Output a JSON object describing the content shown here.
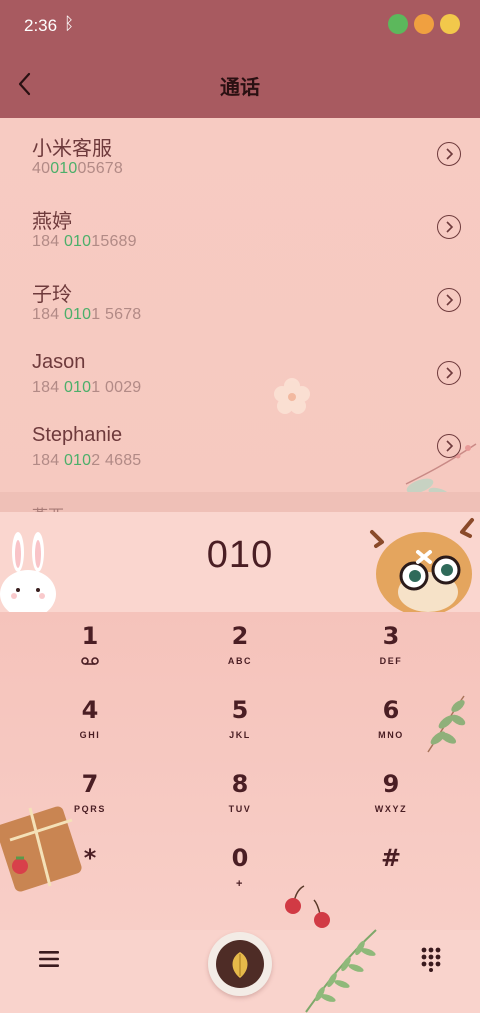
{
  "status": {
    "time": "2:36",
    "bluetooth_glyph": "ᛒ",
    "icons": [
      "clover-icon",
      "fruit-icon",
      "chick-icon"
    ]
  },
  "header": {
    "title": "通话",
    "back_icon": "chevron-left-icon"
  },
  "contacts": [
    {
      "name": "小米客服",
      "num_pre": "40",
      "num_hl": "010",
      "num_post": "05678"
    },
    {
      "name": "燕婷",
      "num_pre": "184 ",
      "num_hl": "010",
      "num_post": "15689"
    },
    {
      "name": "子玲",
      "num_pre": "184 ",
      "num_hl": "010",
      "num_post": "1 5678"
    },
    {
      "name": "Jason",
      "num_pre": "184 ",
      "num_hl": "010",
      "num_post": "1 0029"
    },
    {
      "name": "Stephanie",
      "num_pre": "184 ",
      "num_hl": "010",
      "num_post": "2 4685"
    }
  ],
  "partial_contact": "燕西",
  "dial": {
    "digits": "010"
  },
  "keys": [
    {
      "digit": "1",
      "letters": ""
    },
    {
      "digit": "2",
      "letters": "ABC"
    },
    {
      "digit": "3",
      "letters": "DEF"
    },
    {
      "digit": "4",
      "letters": "GHI"
    },
    {
      "digit": "5",
      "letters": "JKL"
    },
    {
      "digit": "6",
      "letters": "MNO"
    },
    {
      "digit": "7",
      "letters": "PQRS"
    },
    {
      "digit": "8",
      "letters": "TUV"
    },
    {
      "digit": "9",
      "letters": "WXYZ"
    },
    {
      "digit": "*",
      "letters": ""
    },
    {
      "digit": "0",
      "letters": "+"
    },
    {
      "digit": "#",
      "letters": ""
    }
  ],
  "colors": {
    "header": "#a85a60",
    "highlight": "#4caf6a",
    "text": "#6e3a3c"
  }
}
